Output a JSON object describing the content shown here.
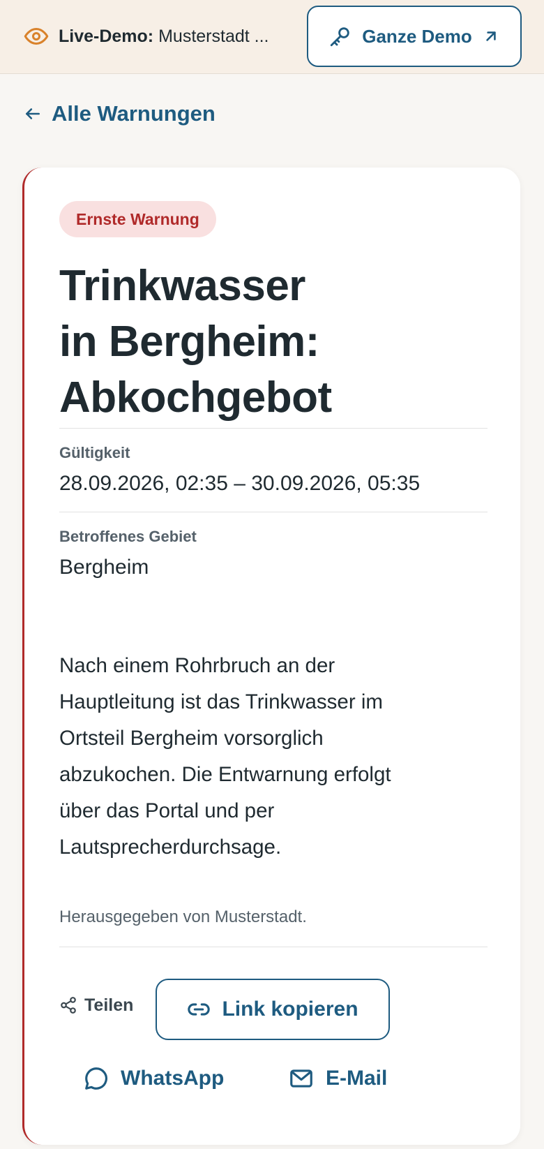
{
  "topbar": {
    "live_label": "Live-Demo:",
    "live_town": "Musterstadt ...",
    "demo_button": "Ganze Demo"
  },
  "nav": {
    "back_label": "Alle Warnungen"
  },
  "warning": {
    "badge": "Ernste Warnung",
    "title_lines": [
      "Trinkwasser",
      "in Bergheim:",
      "Abkochgebot"
    ],
    "validity_label": "Gültigkeit",
    "validity_value": "28.09.2026, 02:35 – 30.09.2026, 05:35",
    "area_label": "Betroffenes Gebiet",
    "area_value": "Bergheim",
    "description_lines": [
      "Nach einem Rohrbruch an der",
      "Hauptleitung ist das Trinkwasser im",
      "Ortsteil Bergheim vorsorglich",
      "abzukochen. Die Entwarnung erfolgt",
      "über das Portal und per",
      "Lautsprecherdurchsage."
    ],
    "issued_by": "Herausgegeben von Musterstadt."
  },
  "share": {
    "label": "Teilen",
    "copy_link": "Link kopieren",
    "whatsapp": "WhatsApp",
    "email": "E-Mail"
  },
  "colors": {
    "accent": "#1e5b80",
    "danger": "#b02a2a",
    "badge_bg": "#f9e0e0",
    "topbar_bg": "#f7efe6",
    "eye_icon": "#d9822b"
  },
  "icons": [
    "eye-icon",
    "key-icon",
    "arrow-up-right-icon",
    "arrow-left-icon",
    "share-icon",
    "link-icon",
    "chat-bubble-icon",
    "mail-icon"
  ]
}
